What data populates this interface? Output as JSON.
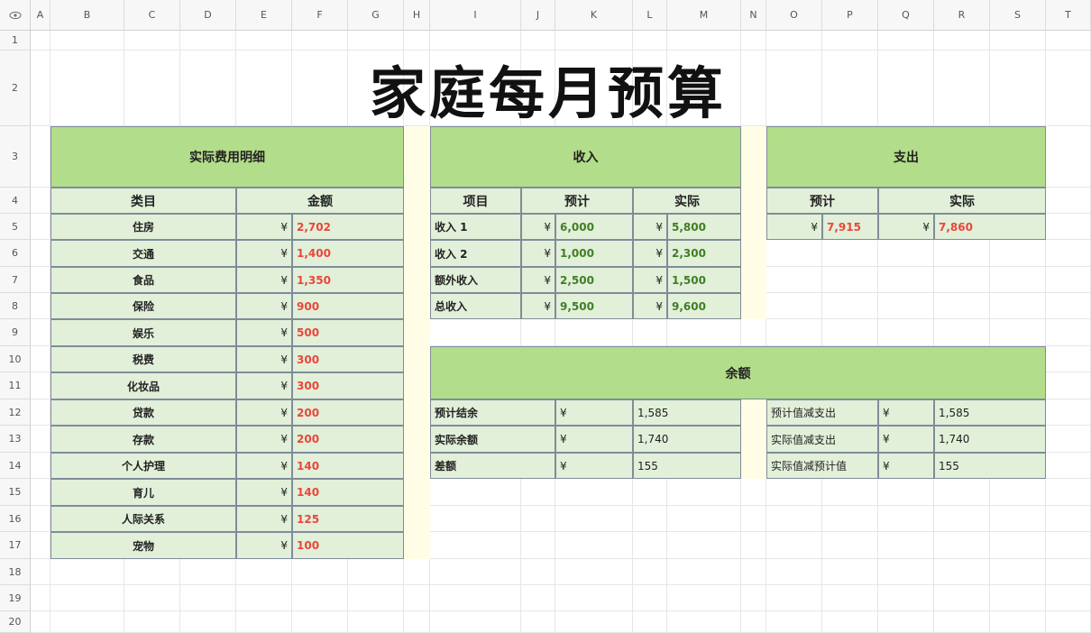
{
  "columns": [
    "A",
    "B",
    "C",
    "D",
    "E",
    "F",
    "G",
    "H",
    "I",
    "J",
    "K",
    "L",
    "M",
    "N",
    "O",
    "P",
    "Q",
    "R",
    "S",
    "T"
  ],
  "rows": [
    "1",
    "2",
    "3",
    "4",
    "5",
    "6",
    "7",
    "8",
    "9",
    "10",
    "11",
    "12",
    "13",
    "14",
    "15",
    "16",
    "17",
    "18",
    "19",
    "20"
  ],
  "title": "家庭每月预算",
  "expense_detail": {
    "header": "实际费用明细",
    "col_category": "类目",
    "col_amount": "金额",
    "currency": "¥",
    "items": [
      {
        "category": "住房",
        "amount": "2,702"
      },
      {
        "category": "交通",
        "amount": "1,400"
      },
      {
        "category": "食品",
        "amount": "1,350"
      },
      {
        "category": "保险",
        "amount": "900"
      },
      {
        "category": "娱乐",
        "amount": "500"
      },
      {
        "category": "税费",
        "amount": "300"
      },
      {
        "category": "化妆品",
        "amount": "300"
      },
      {
        "category": "贷款",
        "amount": "200"
      },
      {
        "category": "存款",
        "amount": "200"
      },
      {
        "category": "个人护理",
        "amount": "140"
      },
      {
        "category": "育儿",
        "amount": "140"
      },
      {
        "category": "人际关系",
        "amount": "125"
      },
      {
        "category": "宠物",
        "amount": "100"
      }
    ]
  },
  "income": {
    "header": "收入",
    "col_item": "项目",
    "col_planned": "预计",
    "col_actual": "实际",
    "currency": "¥",
    "items": [
      {
        "name": "收入 1",
        "planned": "6,000",
        "actual": "5,800"
      },
      {
        "name": "收入 2",
        "planned": "1,000",
        "actual": "2,300"
      },
      {
        "name": "额外收入",
        "planned": "2,500",
        "actual": "1,500"
      },
      {
        "name": "总收入",
        "planned": "9,500",
        "actual": "9,600"
      }
    ]
  },
  "expense": {
    "header": "支出",
    "col_planned": "预计",
    "col_actual": "实际",
    "currency": "¥",
    "planned": "7,915",
    "actual": "7,860"
  },
  "balance": {
    "header": "余额",
    "currency": "¥",
    "left": [
      {
        "label": "预计结余",
        "value": "1,585"
      },
      {
        "label": "实际余额",
        "value": "1,740"
      },
      {
        "label": "差额",
        "value": "155"
      }
    ],
    "right": [
      {
        "label": "预计值减支出",
        "value": "1,585"
      },
      {
        "label": "实际值减支出",
        "value": "1,740"
      },
      {
        "label": "实际值减预计值",
        "value": "155"
      }
    ]
  },
  "colors": {
    "header_green": "#b2dd8a",
    "cell_green": "#e2efd9",
    "spacer_yellow": "#fffde6",
    "expense_red": "#e8473a",
    "income_green": "#3f7f24"
  }
}
